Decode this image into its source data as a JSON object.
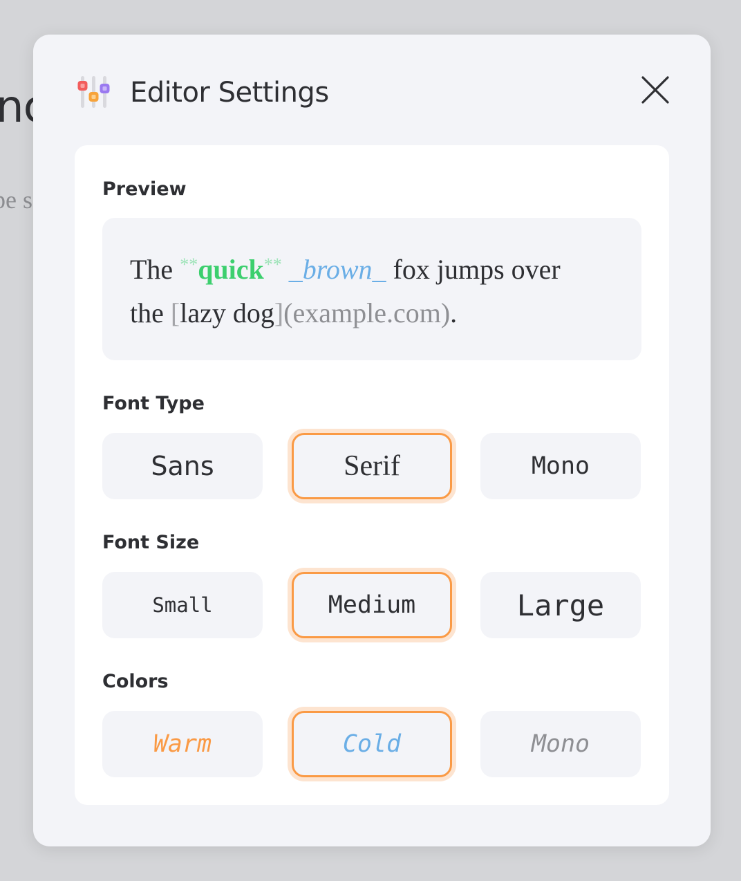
{
  "background": {
    "title_fragment": "nc",
    "text_fragment": "pe s"
  },
  "dialog": {
    "title": "Editor Settings",
    "header_icon": "sliders-icon",
    "close_icon": "close-icon"
  },
  "preview": {
    "label": "Preview",
    "line1": {
      "word_the": "The ",
      "bold_marker_open": "**",
      "bold_word": "quick",
      "bold_marker_close": "**",
      "space1": " ",
      "italic_text": "_brown_",
      "rest": " fox jumps over"
    },
    "line2": {
      "word_the": "the ",
      "bracket_open": "[",
      "link_text": "lazy dog",
      "bracket_close": "]",
      "url": "(example.com)",
      "period": "."
    }
  },
  "font_type": {
    "label": "Font Type",
    "options": [
      "Sans",
      "Serif",
      "Mono"
    ],
    "selected": "Serif"
  },
  "font_size": {
    "label": "Font Size",
    "options": [
      "Small",
      "Medium",
      "Large"
    ],
    "selected": "Medium"
  },
  "colors": {
    "label": "Colors",
    "options": [
      "Warm",
      "Cold",
      "Mono"
    ],
    "selected": "Cold",
    "option_colors": [
      "#fa9a45",
      "#6aaee6",
      "#8e8f93"
    ]
  },
  "theme": {
    "accent": "#fa9a45",
    "accent_glow": "#fde4d0",
    "panel_bg": "#ffffff",
    "dialog_bg": "#f3f4f8",
    "text": "#2e2f33",
    "markdown_bold": "#3ccf6e",
    "markdown_italic": "#6aaee6"
  }
}
